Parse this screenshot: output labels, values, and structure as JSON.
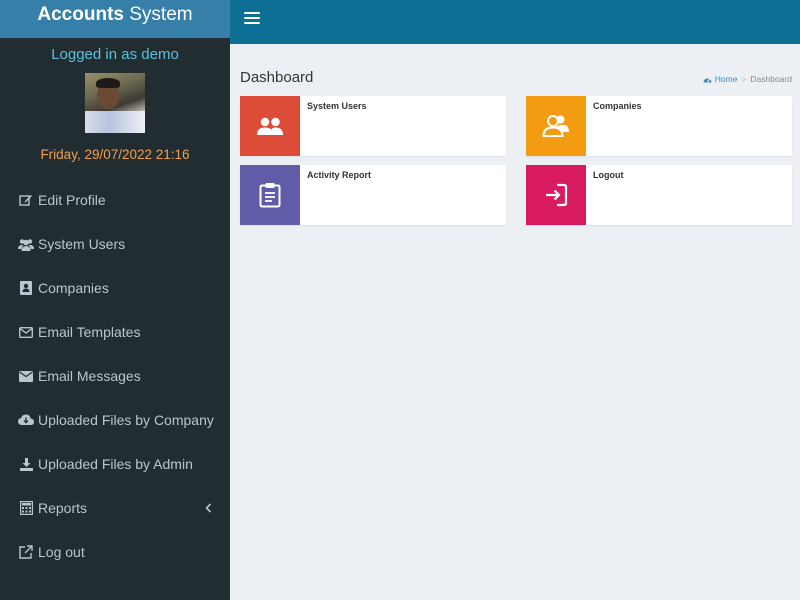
{
  "sidebar": {
    "logo_bold": "Accounts",
    "logo_rest": "System",
    "logged_in": "Logged in as demo",
    "datetime": "Friday, 29/07/2022 21:16",
    "items": [
      {
        "label": "Edit Profile",
        "icon": "edit-icon"
      },
      {
        "label": "System Users",
        "icon": "users-icon"
      },
      {
        "label": "Companies",
        "icon": "address-book-icon"
      },
      {
        "label": "Email Templates",
        "icon": "envelope-outline-icon"
      },
      {
        "label": "Email Messages",
        "icon": "envelope-icon"
      },
      {
        "label": "Uploaded Files by Company",
        "icon": "cloud-download-icon"
      },
      {
        "label": "Uploaded Files by Admin",
        "icon": "download-icon"
      },
      {
        "label": "Reports",
        "icon": "calculator-icon"
      },
      {
        "label": "Log out",
        "icon": "external-link-icon"
      }
    ]
  },
  "header": {
    "menu_icon": "hamburger-icon"
  },
  "main": {
    "title": "Dashboard",
    "breadcrumb": {
      "home": "Home",
      "current": "Dashboard"
    },
    "boxes": [
      {
        "label": "System Users",
        "color": "#dd4b39",
        "icon": "users-icon"
      },
      {
        "label": "Companies",
        "color": "#f39c12",
        "icon": "user-group-icon"
      },
      {
        "label": "Activity Report",
        "color": "#605ca8",
        "icon": "clipboard-icon"
      },
      {
        "label": "Logout",
        "color": "#d81b60",
        "icon": "sign-in-icon"
      }
    ]
  },
  "colors": {
    "sidebar_bg": "#222d32",
    "logo_bg": "#367fa9",
    "topbar_bg": "#0d6f94",
    "content_bg": "#ecf0f5"
  }
}
